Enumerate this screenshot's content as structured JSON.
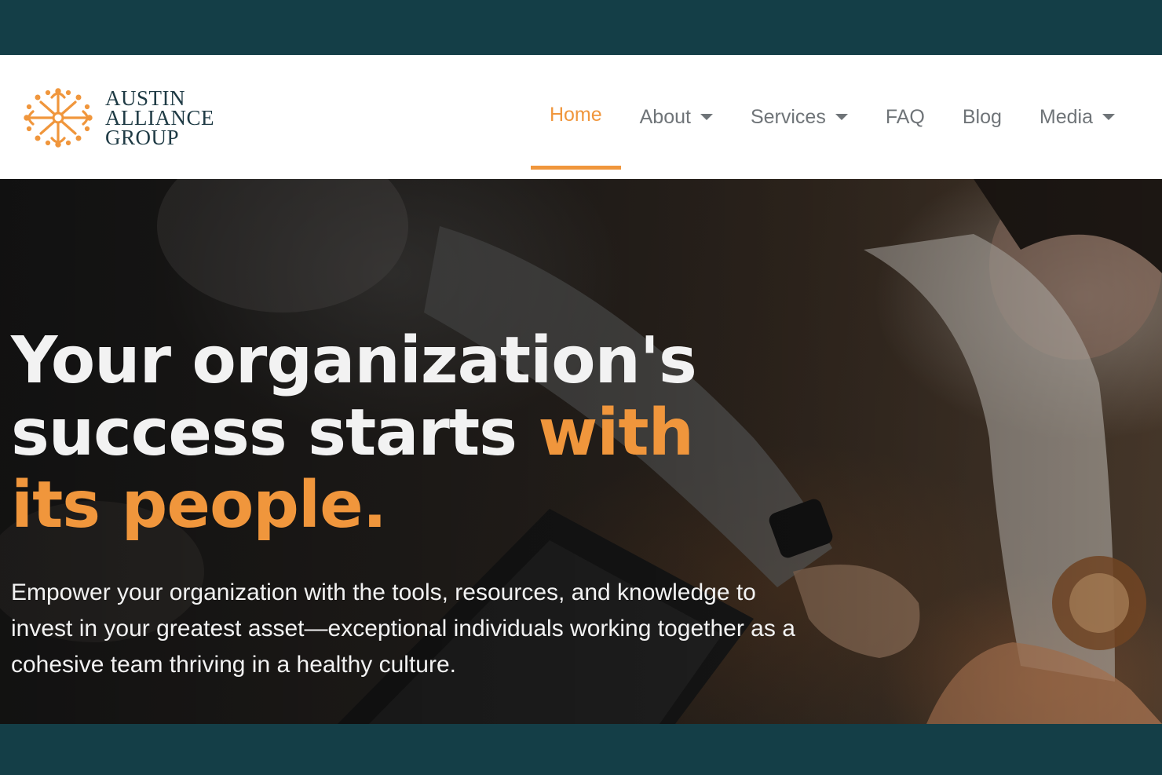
{
  "brand": {
    "line1": "AUSTIN",
    "line2": "ALLIANCE",
    "line3": "GROUP",
    "logo_icon": "sun-burst-logo",
    "accent_color": "#f0963c"
  },
  "nav": {
    "items": [
      {
        "label": "Home",
        "active": true,
        "dropdown": false
      },
      {
        "label": "About",
        "active": false,
        "dropdown": true
      },
      {
        "label": "Services",
        "active": false,
        "dropdown": true
      },
      {
        "label": "FAQ",
        "active": false,
        "dropdown": false
      },
      {
        "label": "Blog",
        "active": false,
        "dropdown": false
      },
      {
        "label": "Media",
        "active": false,
        "dropdown": true
      }
    ]
  },
  "hero": {
    "title_part1": "Your organization's success starts ",
    "title_accent": "with its people.",
    "subtitle": "Empower your organization with the tools, resources, and knowledge to invest in your greatest asset—exceptional individuals working together as a cohesive team thriving in a healthy culture."
  },
  "colors": {
    "frame": "#143e47",
    "accent": "#f0963c",
    "nav_text": "#6f7478",
    "logo_text": "#1e3a44"
  }
}
